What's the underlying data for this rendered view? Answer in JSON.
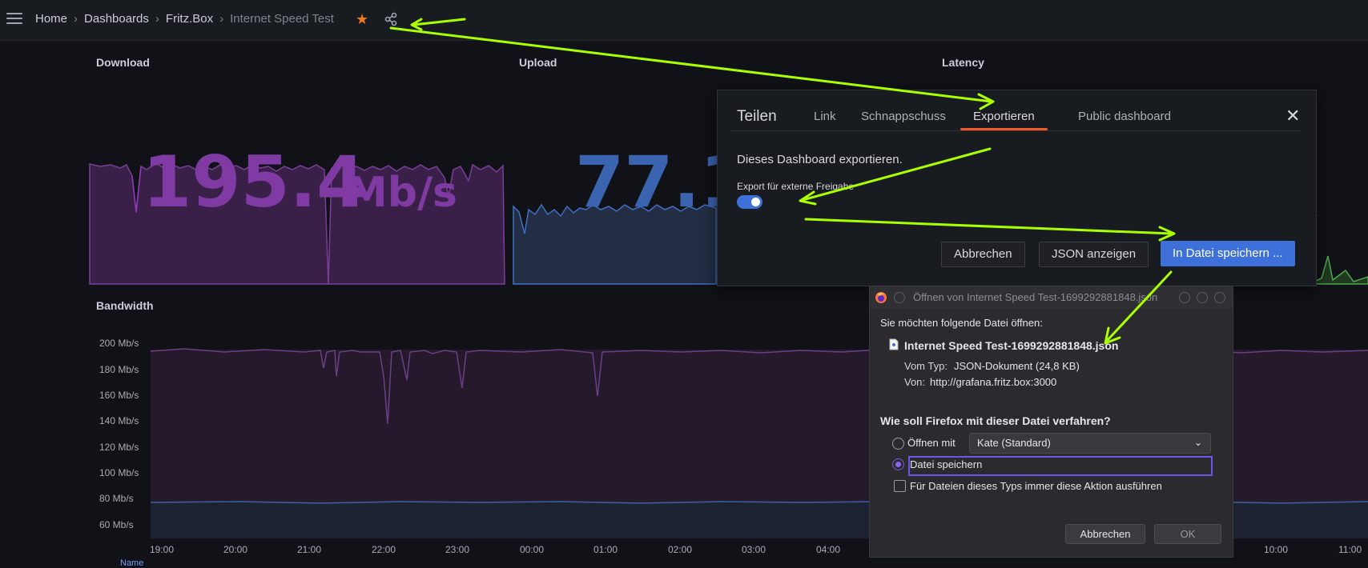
{
  "breadcrumb": [
    "Home",
    "Dashboards",
    "Fritz.Box",
    "Internet Speed Test"
  ],
  "panels": {
    "download": "Download",
    "upload": "Upload",
    "latency": "Latency",
    "bandwidth": "Bandwidth"
  },
  "stats": {
    "download": "195.4",
    "download_unit": "Mb/s",
    "upload": "77.1"
  },
  "bandwidth": {
    "y_ticks": [
      "200 Mb/s",
      "180 Mb/s",
      "160 Mb/s",
      "140 Mb/s",
      "120 Mb/s",
      "100 Mb/s",
      "80 Mb/s",
      "60 Mb/s"
    ],
    "x_ticks": [
      "19:00",
      "20:00",
      "21:00",
      "22:00",
      "23:00",
      "00:00",
      "01:00",
      "02:00",
      "03:00",
      "04:00",
      "10:00",
      "11:00"
    ],
    "legend_header": "Name"
  },
  "share_dialog": {
    "title": "Teilen",
    "tabs": [
      "Link",
      "Schnappschuss",
      "Exportieren",
      "Public dashboard"
    ],
    "active_tab": "Exportieren",
    "description": "Dieses Dashboard exportieren.",
    "toggle_label": "Export für externe Freigabe",
    "toggle_on": true,
    "buttons": {
      "cancel": "Abbrechen",
      "view_json": "JSON anzeigen",
      "save": "In Datei speichern ..."
    }
  },
  "firefox_dialog": {
    "title": "Öffnen von Internet Speed Test-1699292881848.json",
    "prompt": "Sie möchten folgende Datei öffnen:",
    "filename": "Internet Speed Test-1699292881848.json",
    "type_label": "Vom Typ:",
    "type_value": "JSON-Dokument (24,8 KB)",
    "from_label": "Von:",
    "from_value": "http://grafana.fritz.box:3000",
    "question": "Wie soll Firefox mit dieser Datei verfahren?",
    "open_with": "Öffnen mit",
    "app": "Kate (Standard)",
    "save_file": "Datei speichern",
    "always": "Für Dateien dieses Typs immer diese Aktion ausführen",
    "cancel": "Abbrechen",
    "ok": "OK"
  },
  "colors": {
    "accent": "#3d71d9",
    "tab_underline": "#f05a28",
    "arrow": "#aaff00",
    "download": "#8f3bb8",
    "upload": "#3f70c4"
  }
}
